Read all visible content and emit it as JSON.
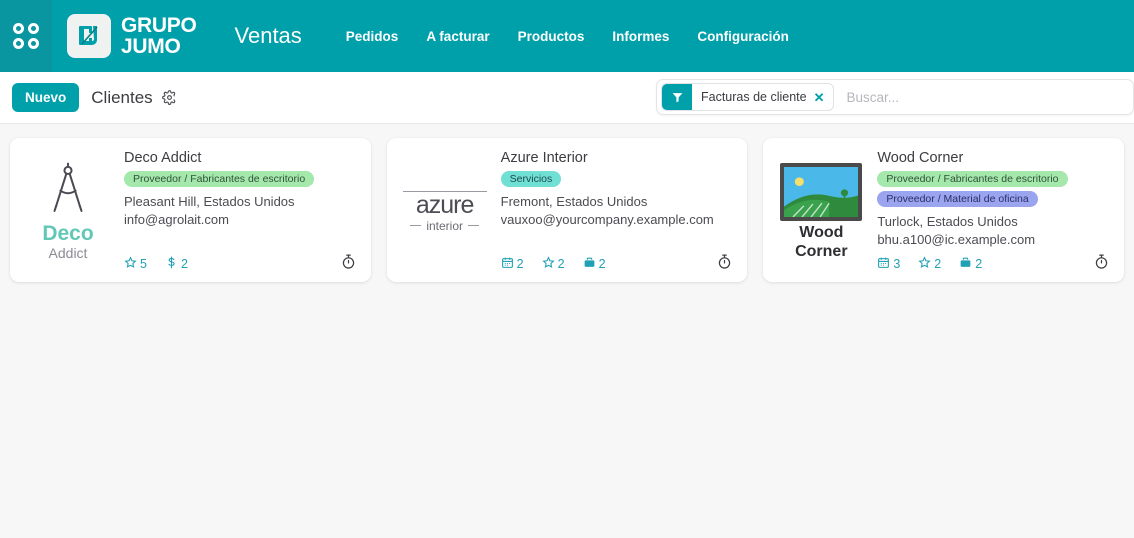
{
  "navbar": {
    "apps_icon": "apps-grid-icon",
    "brand": {
      "line1": "GRUPO",
      "line2": "JUMO",
      "mark_icon": "jumo-logo-icon"
    },
    "app_title": "Ventas",
    "menu": [
      {
        "label": "Pedidos"
      },
      {
        "label": "A facturar"
      },
      {
        "label": "Productos"
      },
      {
        "label": "Informes"
      },
      {
        "label": "Configuración"
      }
    ],
    "bg_color": "#00a0ab"
  },
  "control_bar": {
    "new_button": "Nuevo",
    "breadcrumb": "Clientes",
    "gear_icon": "gear-icon",
    "search": {
      "facet_icon": "filter-icon",
      "facet_label": "Facturas de cliente",
      "facet_remove": "✕",
      "placeholder": "Buscar...",
      "value": ""
    }
  },
  "cards": [
    {
      "name": "Deco Addict",
      "logo_kind": "deco",
      "logo_name": "Deco",
      "logo_sub": "Addict",
      "tags": [
        {
          "text": "Proveedor / Fabricantes de escritorio",
          "style": "tag-green"
        }
      ],
      "location": "Pleasant Hill, Estados Unidos",
      "email": "info@agrolait.com",
      "stats": [
        {
          "icon": "star-icon",
          "value": "5"
        },
        {
          "icon": "dollar-icon",
          "value": "2"
        }
      ],
      "timer_icon": "stopwatch-icon"
    },
    {
      "name": "Azure Interior",
      "logo_kind": "azure",
      "logo_name": "azure",
      "logo_sub": "interior",
      "tags": [
        {
          "text": "Servicios",
          "style": "tag-teal"
        }
      ],
      "location": "Fremont, Estados Unidos",
      "email": "vauxoo@yourcompany.example.com",
      "stats": [
        {
          "icon": "calendar-icon",
          "value": "2"
        },
        {
          "icon": "star-icon",
          "value": "2"
        },
        {
          "icon": "briefcase-icon",
          "value": "2"
        }
      ],
      "timer_icon": "stopwatch-icon"
    },
    {
      "name": "Wood Corner",
      "logo_kind": "wood",
      "logo_name": "Wood",
      "logo_sub": "Corner",
      "tags": [
        {
          "text": "Proveedor / Fabricantes de escritorio",
          "style": "tag-green"
        },
        {
          "text": "Proveedor / Material de oficina",
          "style": "tag-purple"
        }
      ],
      "location": "Turlock, Estados Unidos",
      "email": "bhu.a100@ic.example.com",
      "stats": [
        {
          "icon": "calendar-icon",
          "value": "3"
        },
        {
          "icon": "star-icon",
          "value": "2"
        },
        {
          "icon": "briefcase-icon",
          "value": "2"
        }
      ],
      "timer_icon": "stopwatch-icon"
    }
  ],
  "colors": {
    "brand_teal": "#00a0ab",
    "accent_link": "#22a0b4",
    "page_bg": "#f7f7f8"
  }
}
